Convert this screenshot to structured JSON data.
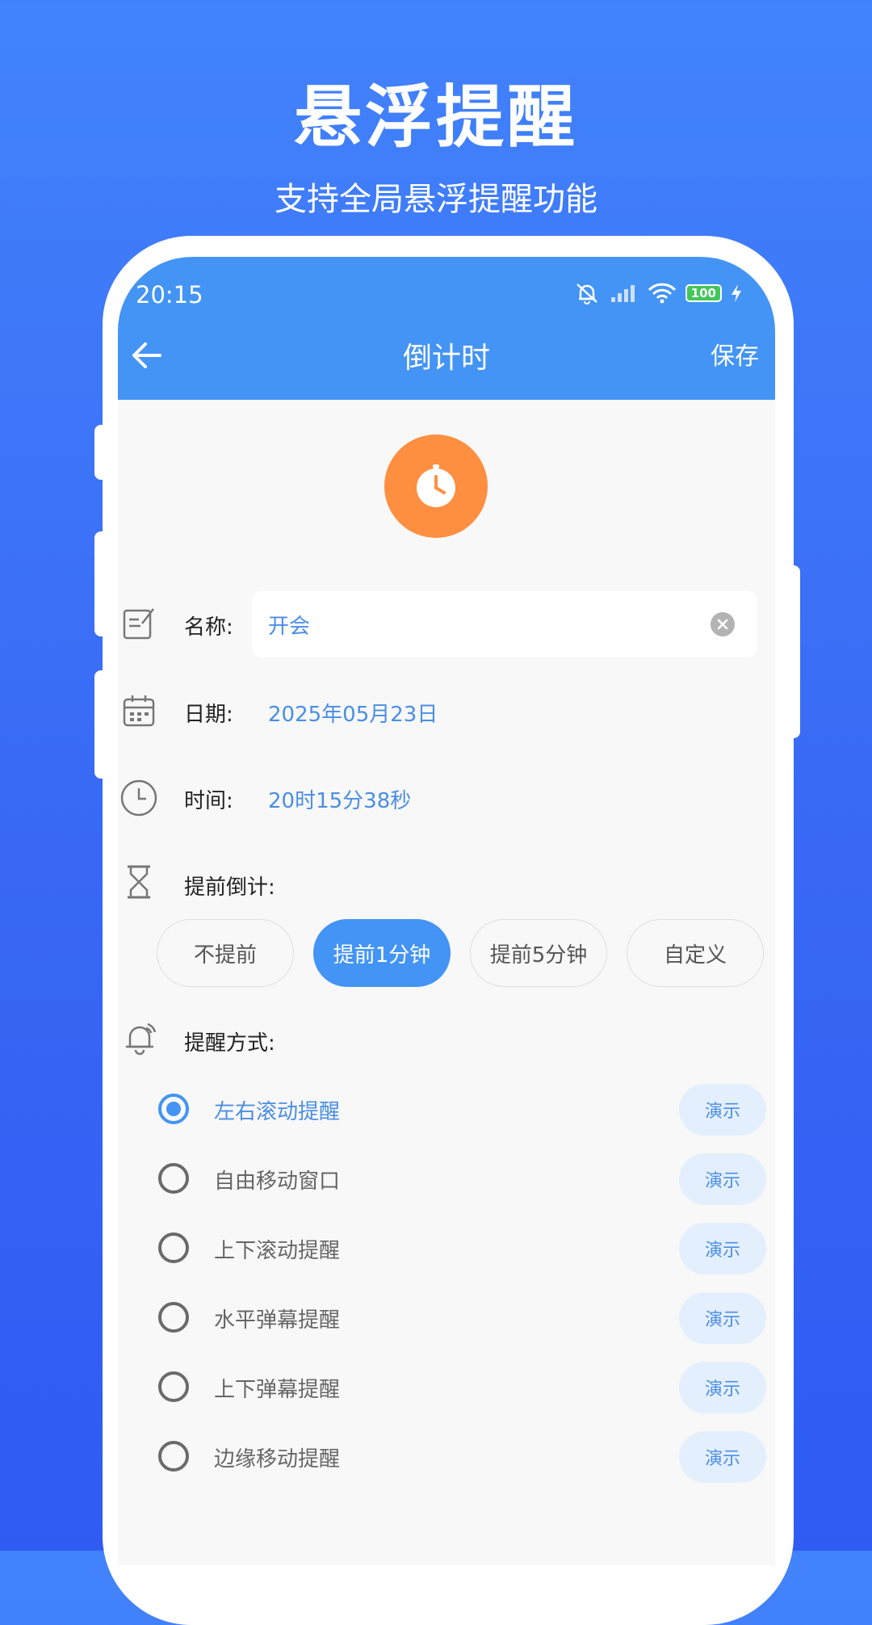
{
  "promo": {
    "title": "悬浮提醒",
    "subtitle": "支持全局悬浮提醒功能"
  },
  "status_bar": {
    "time": "20:15",
    "battery": "100"
  },
  "header": {
    "title": "倒计时",
    "save_label": "保存",
    "back_icon": "arrow-left-icon"
  },
  "form": {
    "name": {
      "label": "名称:",
      "value": "开会"
    },
    "date": {
      "label": "日期:",
      "value": "2025年05月23日"
    },
    "time": {
      "label": "时间:",
      "value": "20时15分38秒"
    },
    "advance": {
      "label": "提前倒计:",
      "options": [
        "不提前",
        "提前1分钟",
        "提前5分钟",
        "自定义"
      ],
      "selected": "提前1分钟"
    },
    "reminder": {
      "label": "提醒方式:",
      "demo_label": "演示",
      "options": [
        "左右滚动提醒",
        "自由移动窗口",
        "上下滚动提醒",
        "水平弹幕提醒",
        "上下弹幕提醒",
        "边缘移动提醒"
      ],
      "selected": "左右滚动提醒"
    }
  },
  "colors": {
    "accent": "#4394f4",
    "timer_badge": "#fe8f40",
    "value_text": "#4a8ee4"
  }
}
